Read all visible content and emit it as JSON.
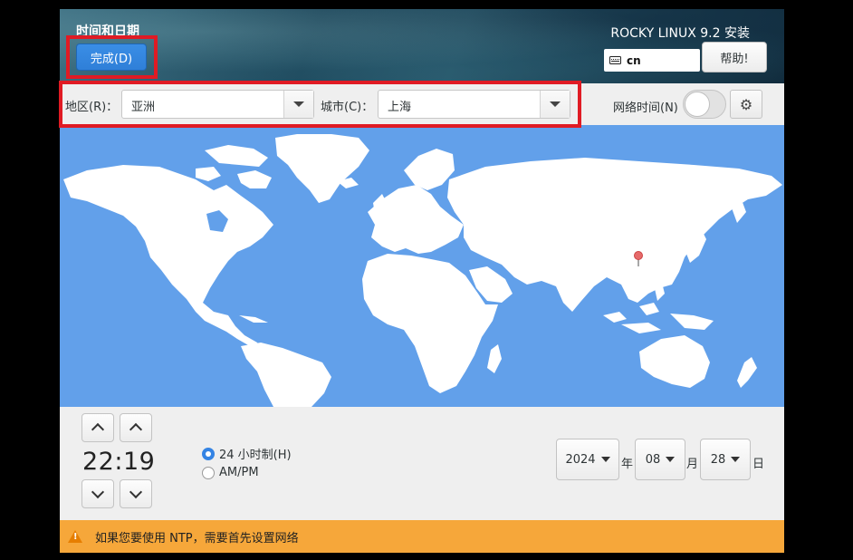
{
  "header": {
    "spoke_title": "时间和日期",
    "done_label": "完成(D)",
    "product_title": "ROCKY LINUX 9.2 安装",
    "keyboard_layout": "cn",
    "help_label": "帮助!"
  },
  "toolbar": {
    "region_label": "地区(R)：",
    "region_value": "亚洲",
    "city_label": "城市(C)：",
    "city_value": "上海",
    "network_time_label": "网络时间(N)",
    "network_time_on": false
  },
  "map": {
    "selected_city": "上海",
    "ocean_color": "#62a0ea",
    "land_color": "#ffffff",
    "pin_color": "#e66a6a"
  },
  "time": {
    "hours": "22",
    "minutes": "19",
    "separator": ":",
    "format_24h_label": "24 小时制(H)",
    "format_ampm_label": "AM/PM",
    "selected_format": "24h"
  },
  "date": {
    "year": "2024",
    "year_unit": "年",
    "month": "08",
    "month_unit": "月",
    "day": "28",
    "day_unit": "日"
  },
  "warning": {
    "icon": "warning-icon",
    "text": "如果您要使用 NTP，需要首先设置网络",
    "color": "#f6a73a"
  },
  "highlight_color": "#e01b24"
}
